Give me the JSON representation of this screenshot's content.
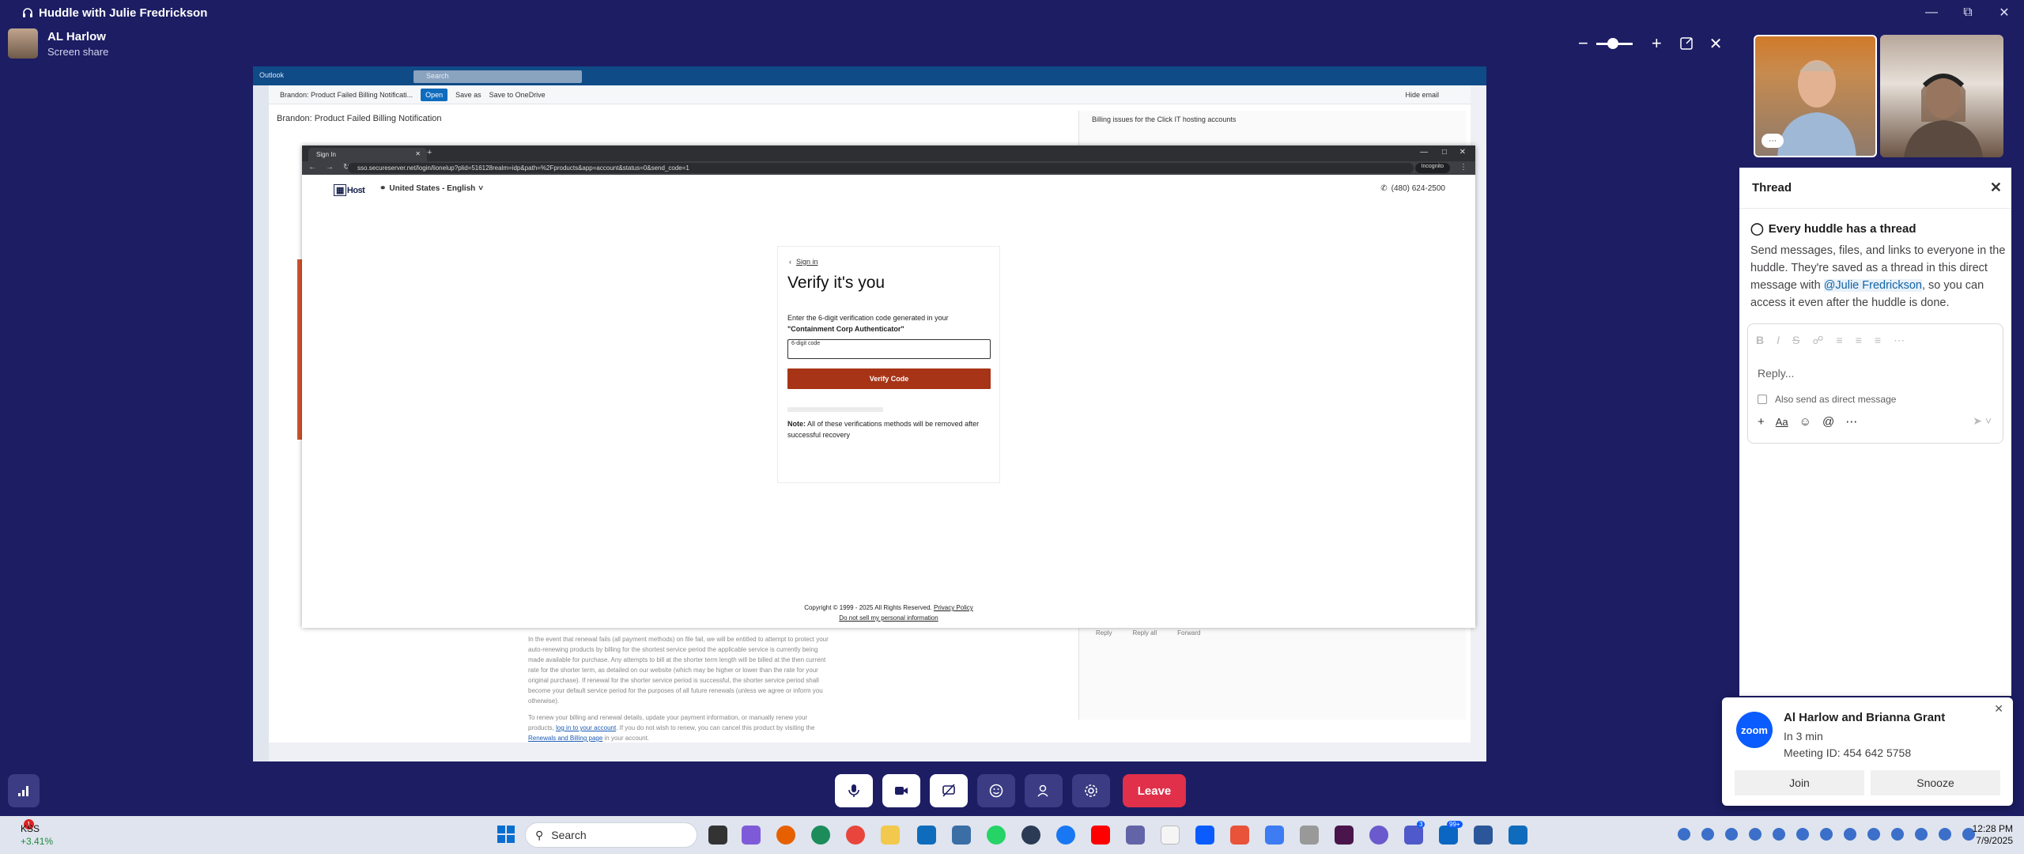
{
  "window": {
    "title": "Huddle with Julie Fredrickson"
  },
  "sharer": {
    "name": "AL Harlow",
    "status": "Screen share"
  },
  "outlook": {
    "app_label": "Outlook",
    "search_placeholder": "Search",
    "tab_title": "Brandon: Product Failed Billing Notificati...",
    "open_label": "Open",
    "save_as": "Save as",
    "save_onedrive": "Save to OneDrive",
    "hide_email": "Hide email",
    "subject": "Brandon: Product Failed Billing Notification",
    "right_title": "Billing issues for the Click IT hosting accounts",
    "reply": "Reply",
    "reply_all": "Reply all",
    "forward": "Forward",
    "body_p1": "In the event that renewal fails (all payment methods) on file fail, we will be entitled to attempt to protect your auto-renewing products by billing for the shortest service period the applicable service is currently being made available for purchase. Any attempts to bill at the shorter term length will be billed at the then current rate for the shorter term, as detailed on our website (which may be higher or lower than the rate for your original purchase). If renewal for the shorter service period is successful, the shorter service period shall become your default service period for the purposes of all future renewals (unless we agree or inform you otherwise).",
    "body_p2a": "To renew your billing and renewal details, update your payment information, or manually renew your products,",
    "body_link1": "log in to your account",
    "body_p2b": ". If you do not wish to renew, you can cancel this product by visiting the",
    "body_link2": "Renewals and Billing page",
    "body_p2c": "in your account."
  },
  "browser": {
    "tab_title": "Sign In",
    "url": "sso.secureserver.net/login/lionelup?plid=516128realm=idp&path=%2Fproducts&app=account&status=0&send_code=1",
    "incognito": "Incognito"
  },
  "page": {
    "logo": "Host",
    "region": "United States - English",
    "phone": "(480) 624-2500",
    "back": "Sign in",
    "title": "Verify it's you",
    "desc_1": "Enter the 6-digit verification code generated in your",
    "desc_2": "\"Containment Corp Authenticator\"",
    "input_label": "6-digit code",
    "button": "Verify Code",
    "note_label": "Note:",
    "note_text": "All of these verifications methods will be removed after successful recovery",
    "footer_copyright": "Copyright © 1999 - 2025 All Rights Reserved.",
    "footer_privacy": "Privacy Policy",
    "footer_dns": "Do not sell my personal information"
  },
  "thread": {
    "title": "Thread",
    "heading": "Every huddle has a thread",
    "p1": "Send messages, files, and links to everyone in the huddle. They're saved as a thread in this direct message with",
    "mention": "@Julie Fredrickson",
    "p2": ", so you can access it even after the huddle is done.",
    "reply_placeholder": "Reply...",
    "also_send": "Also send as direct message"
  },
  "notification": {
    "logo": "zoom",
    "title": "Al Harlow and Brianna Grant",
    "line1": "In 3 min",
    "line2": "Meeting ID: 454 642 5758",
    "join": "Join",
    "snooze": "Snooze"
  },
  "controls": {
    "leave": "Leave"
  },
  "taskbar": {
    "ticker": "KSS",
    "change": "+3.41%",
    "ticker_badge": "1",
    "search": "Search",
    "time": "12:28 PM",
    "date": "7/9/2025",
    "badge_teams": "3",
    "badge_outlook": "99+"
  },
  "colors": {
    "slack_bg": "#1c1d63",
    "leave": "#e0304a",
    "verify": "#a73417",
    "zoom": "#0b5cff"
  }
}
